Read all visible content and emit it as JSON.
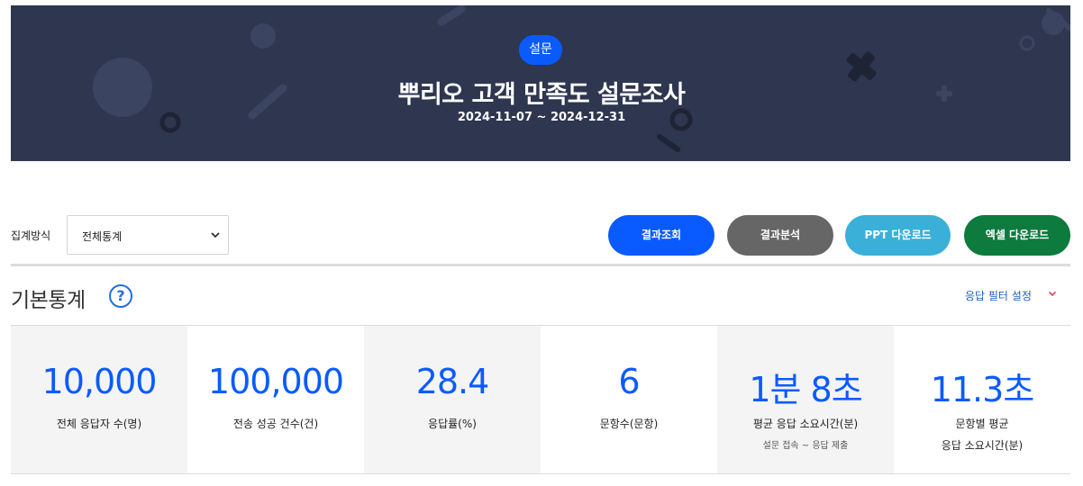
{
  "banner": {
    "badge": "설문",
    "title": "뿌리오 고객 만족도 설문조사",
    "period": "2024-11-07 ~ 2024-12-31"
  },
  "toolbar": {
    "aggregation_label": "집계방식",
    "aggregation_value": "전체통계",
    "buttons": {
      "result": "결과조회",
      "analysis": "결과분석",
      "ppt": "PPT 다운로드",
      "excel": "엑셀 다운로드"
    }
  },
  "section": {
    "title": "기본통계",
    "help_glyph": "?",
    "filter_label": "응답 필터 설정"
  },
  "stats": [
    {
      "value": "10,000",
      "label": "전체 응답자 수(명)"
    },
    {
      "value": "100,000",
      "label": "전송 성공 건수(건)"
    },
    {
      "value": "28.4",
      "label": "응답률(%)"
    },
    {
      "value": "6",
      "label": "문항수(문항)"
    },
    {
      "value": "1분 8초",
      "label": "평균 응답 소요시간(분)",
      "sub": "설문 접속 ~ 응답 제출"
    },
    {
      "value": "11.3초",
      "label_line1": "문항별 평균",
      "label_line2": "응답 소요시간(분)"
    }
  ],
  "colors": {
    "banner_bg": "#2e3650",
    "accent_blue": "#0a5bff",
    "analysis_gray": "#666666",
    "ppt_cyan": "#3ab0d8",
    "excel_green": "#0d7a3e"
  }
}
